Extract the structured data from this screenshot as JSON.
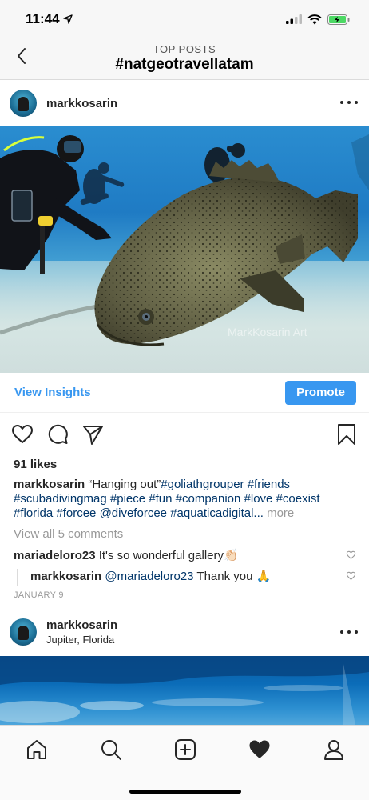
{
  "status_bar": {
    "time": "11:44"
  },
  "header": {
    "subtitle": "TOP POSTS",
    "title": "#natgeotravellatam"
  },
  "post": {
    "username": "markkosarin",
    "image_watermark": "MarkKosarin Art",
    "insights_label": "View Insights",
    "promote_label": "Promote",
    "likes": "91 likes",
    "caption_user": "markkosarin",
    "caption_text": "“Hanging out”",
    "caption_tags_line1": "#goliathgrouper #friends",
    "caption_tags_line2": "#scubadivingmag #piece #fun #companion #love #coexist",
    "caption_tags_line3": "#florida #forcee @diveforcee #aquaticadigital...",
    "caption_more": "more",
    "view_comments": "View all 5 comments",
    "comments": [
      {
        "user": "mariadeloro23",
        "text": "It's so wonderful gallery👏🏻"
      }
    ],
    "reply": {
      "user": "markkosarin",
      "mention": "@mariadeloro23",
      "text": "Thank you 🙏"
    },
    "timestamp": "JANUARY 9"
  },
  "post2": {
    "username": "markkosarin",
    "location": "Jupiter, Florida"
  },
  "colors": {
    "accent": "#3897f0",
    "hashtag": "#003569",
    "muted": "#999999"
  }
}
